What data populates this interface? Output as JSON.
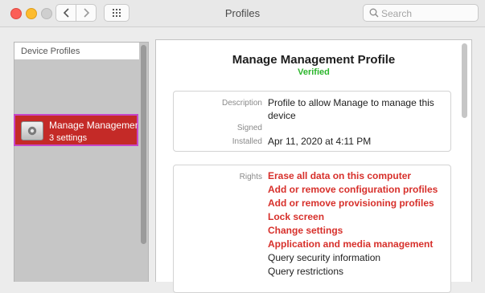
{
  "window": {
    "title": "Profiles",
    "search_placeholder": "Search"
  },
  "sidebar": {
    "header": "Device Profiles",
    "items": [
      {
        "name": "Manage Management Profile",
        "subtitle": "3 settings",
        "selected": true
      }
    ]
  },
  "profile": {
    "title": "Manage Management Profile",
    "status": "Verified",
    "status_color": "#2bb52b",
    "details": {
      "description_label": "Description",
      "description_value": "Profile to allow Manage to manage this device",
      "signed_label": "Signed",
      "signed_value": "",
      "installed_label": "Installed",
      "installed_value": "Apr 11, 2020 at 4:11 PM"
    },
    "rights_label": "Rights",
    "rights": [
      {
        "text": "Erase all data on this computer",
        "highlight": true
      },
      {
        "text": "Add or remove configuration profiles",
        "highlight": true
      },
      {
        "text": "Add or remove provisioning profiles",
        "highlight": true
      },
      {
        "text": "Lock screen",
        "highlight": true
      },
      {
        "text": "Change settings",
        "highlight": true
      },
      {
        "text": "Application and media management",
        "highlight": true
      },
      {
        "text": "Query security information",
        "highlight": false
      },
      {
        "text": "Query restrictions",
        "highlight": false
      }
    ],
    "highlight_color": "#d7302b"
  },
  "icons": [
    "back-arrow-icon",
    "forward-arrow-icon",
    "grid-icon",
    "search-icon",
    "profile-gear-icon"
  ]
}
